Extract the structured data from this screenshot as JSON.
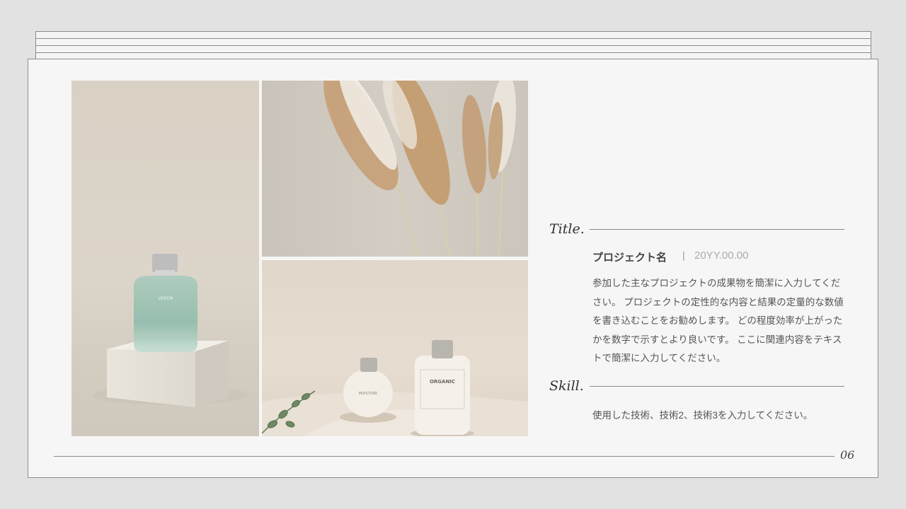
{
  "title_label": "Title.",
  "project": {
    "name": "プロジェクト名",
    "separator": "|",
    "date": "20YY.00.00",
    "description": "参加した主なプロジェクトの成果物を簡潔に入力してください。 プロジェクトの定性的な内容と結果の定量的な数値を書き込むことをお勧めします。 どの程度効率が上がったかを数字で示すとより良いです。 ここに関連内容をテキストで簡潔に入力してください。"
  },
  "skill_label": "Skill.",
  "skill_text": "使用した技術、技術2、技術3を入力してください。",
  "page_number": "06",
  "images": {
    "bottle_label": "VERON",
    "jar_label": "MOISTURE",
    "organic_label": "ORGANIC"
  },
  "colors": {
    "background": "#e2e2e2",
    "page": "#f7f6f6",
    "border": "#8e8e8e",
    "text": "#555555"
  }
}
